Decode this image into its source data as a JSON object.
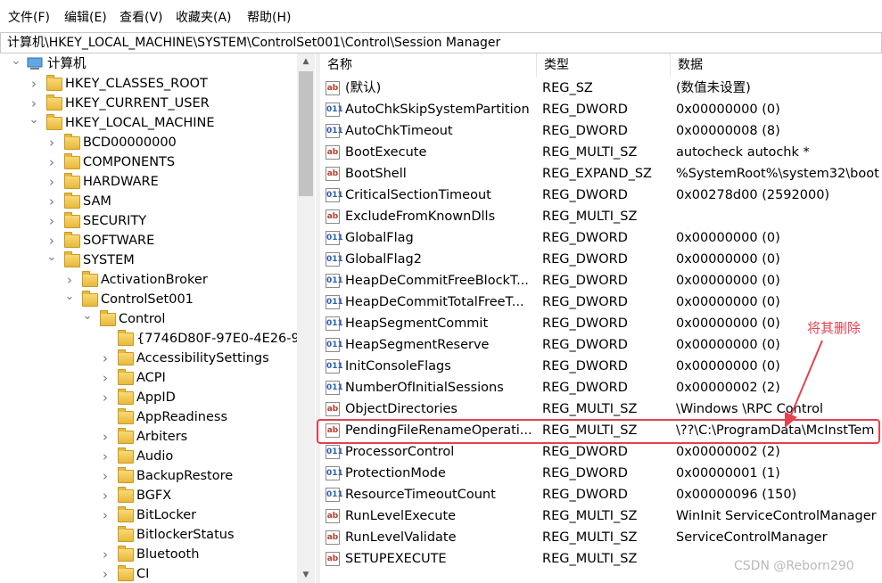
{
  "menu": [
    "文件(F)",
    "编辑(E)",
    "查看(V)",
    "收藏夹(A)",
    "帮助(H)"
  ],
  "address": "计算机\\HKEY_LOCAL_MACHINE\\SYSTEM\\ControlSet001\\Control\\Session Manager",
  "tree": [
    {
      "label": "计算机",
      "state": "expanded",
      "icon": "computer-icon"
    },
    {
      "label": "HKEY_CLASSES_ROOT",
      "state": "collapsed",
      "icon": "folder-icon"
    },
    {
      "label": "HKEY_CURRENT_USER",
      "state": "collapsed",
      "icon": "folder-icon"
    },
    {
      "label": "HKEY_LOCAL_MACHINE",
      "state": "expanded",
      "icon": "folder-icon"
    },
    {
      "label": "BCD00000000",
      "state": "collapsed",
      "icon": "folder-icon"
    },
    {
      "label": "COMPONENTS",
      "state": "collapsed",
      "icon": "folder-icon"
    },
    {
      "label": "HARDWARE",
      "state": "collapsed",
      "icon": "folder-icon"
    },
    {
      "label": "SAM",
      "state": "collapsed",
      "icon": "folder-icon"
    },
    {
      "label": "SECURITY",
      "state": "collapsed",
      "icon": "folder-icon"
    },
    {
      "label": "SOFTWARE",
      "state": "collapsed",
      "icon": "folder-icon"
    },
    {
      "label": "SYSTEM",
      "state": "expanded",
      "icon": "folder-icon"
    },
    {
      "label": "ActivationBroker",
      "state": "collapsed",
      "icon": "folder-icon"
    },
    {
      "label": "ControlSet001",
      "state": "expanded",
      "icon": "folder-icon"
    },
    {
      "label": "Control",
      "state": "expanded",
      "icon": "folder-icon"
    },
    {
      "label": "{7746D80F-97E0-4E26-95",
      "state": "none",
      "icon": "folder-icon"
    },
    {
      "label": "AccessibilitySettings",
      "state": "collapsed",
      "icon": "folder-icon"
    },
    {
      "label": "ACPI",
      "state": "collapsed",
      "icon": "folder-icon"
    },
    {
      "label": "AppID",
      "state": "collapsed",
      "icon": "folder-icon"
    },
    {
      "label": "AppReadiness",
      "state": "none",
      "icon": "folder-icon"
    },
    {
      "label": "Arbiters",
      "state": "collapsed",
      "icon": "folder-icon"
    },
    {
      "label": "Audio",
      "state": "collapsed",
      "icon": "folder-icon"
    },
    {
      "label": "BackupRestore",
      "state": "collapsed",
      "icon": "folder-icon"
    },
    {
      "label": "BGFX",
      "state": "collapsed",
      "icon": "folder-icon"
    },
    {
      "label": "BitLocker",
      "state": "collapsed",
      "icon": "folder-icon"
    },
    {
      "label": "BitlockerStatus",
      "state": "none",
      "icon": "folder-icon"
    },
    {
      "label": "Bluetooth",
      "state": "collapsed",
      "icon": "folder-icon"
    },
    {
      "label": "CI",
      "state": "collapsed",
      "icon": "folder-icon"
    }
  ],
  "columns": {
    "name": "名称",
    "type": "类型",
    "data": "数据"
  },
  "values": [
    {
      "name": "(默认)",
      "type": "REG_SZ",
      "data": "(数值未设置)",
      "kind": "sz"
    },
    {
      "name": "AutoChkSkipSystemPartition",
      "type": "REG_DWORD",
      "data": "0x00000000 (0)",
      "kind": "dword"
    },
    {
      "name": "AutoChkTimeout",
      "type": "REG_DWORD",
      "data": "0x00000008 (8)",
      "kind": "dword"
    },
    {
      "name": "BootExecute",
      "type": "REG_MULTI_SZ",
      "data": "autocheck autochk *",
      "kind": "sz"
    },
    {
      "name": "BootShell",
      "type": "REG_EXPAND_SZ",
      "data": "%SystemRoot%\\system32\\boot",
      "kind": "sz"
    },
    {
      "name": "CriticalSectionTimeout",
      "type": "REG_DWORD",
      "data": "0x00278d00 (2592000)",
      "kind": "dword"
    },
    {
      "name": "ExcludeFromKnownDlls",
      "type": "REG_MULTI_SZ",
      "data": "",
      "kind": "sz"
    },
    {
      "name": "GlobalFlag",
      "type": "REG_DWORD",
      "data": "0x00000000 (0)",
      "kind": "dword"
    },
    {
      "name": "GlobalFlag2",
      "type": "REG_DWORD",
      "data": "0x00000000 (0)",
      "kind": "dword"
    },
    {
      "name": "HeapDeCommitFreeBlockT...",
      "type": "REG_DWORD",
      "data": "0x00000000 (0)",
      "kind": "dword"
    },
    {
      "name": "HeapDeCommitTotalFreeT...",
      "type": "REG_DWORD",
      "data": "0x00000000 (0)",
      "kind": "dword"
    },
    {
      "name": "HeapSegmentCommit",
      "type": "REG_DWORD",
      "data": "0x00000000 (0)",
      "kind": "dword"
    },
    {
      "name": "HeapSegmentReserve",
      "type": "REG_DWORD",
      "data": "0x00000000 (0)",
      "kind": "dword"
    },
    {
      "name": "InitConsoleFlags",
      "type": "REG_DWORD",
      "data": "0x00000000 (0)",
      "kind": "dword"
    },
    {
      "name": "NumberOfInitialSessions",
      "type": "REG_DWORD",
      "data": "0x00000002 (2)",
      "kind": "dword"
    },
    {
      "name": "ObjectDirectories",
      "type": "REG_MULTI_SZ",
      "data": "\\Windows \\RPC Control",
      "kind": "sz"
    },
    {
      "name": "PendingFileRenameOperati...",
      "type": "REG_MULTI_SZ",
      "data": "\\??\\C:\\ProgramData\\McInstTem",
      "kind": "sz"
    },
    {
      "name": "ProcessorControl",
      "type": "REG_DWORD",
      "data": "0x00000002 (2)",
      "kind": "dword"
    },
    {
      "name": "ProtectionMode",
      "type": "REG_DWORD",
      "data": "0x00000001 (1)",
      "kind": "dword"
    },
    {
      "name": "ResourceTimeoutCount",
      "type": "REG_DWORD",
      "data": "0x00000096 (150)",
      "kind": "dword"
    },
    {
      "name": "RunLevelExecute",
      "type": "REG_MULTI_SZ",
      "data": "WinInit ServiceControlManager",
      "kind": "sz"
    },
    {
      "name": "RunLevelValidate",
      "type": "REG_MULTI_SZ",
      "data": "ServiceControlManager",
      "kind": "sz"
    },
    {
      "name": "SETUPEXECUTE",
      "type": "REG_MULTI_SZ",
      "data": "",
      "kind": "sz"
    }
  ],
  "annotation": "将其删除",
  "watermark": "CSDN @Reborn290",
  "colors": {
    "annotation": "#e5414f",
    "folder": "#f0c65a",
    "dword_icon": "#2a5db0",
    "sz_icon": "#c0392b"
  }
}
